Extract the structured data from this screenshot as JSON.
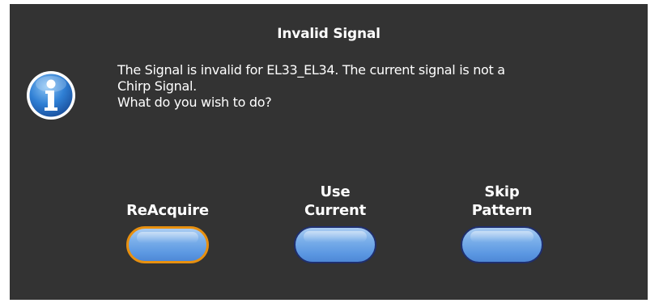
{
  "dialog": {
    "title": "Invalid Signal",
    "icon": "info-icon",
    "message": {
      "line1": "The Signal is invalid for EL33_EL34. The current signal is not a",
      "line2": "Chirp Signal.",
      "line3": "What do you wish to do?"
    }
  },
  "buttons": {
    "reacquire": {
      "label": "ReAcquire"
    },
    "use_current": {
      "line1": "Use",
      "line2": "Current"
    },
    "skip_pattern": {
      "line1": "Skip",
      "line2": "Pattern"
    }
  },
  "colors": {
    "background": "#333333",
    "button_fill": "#5c98e2",
    "button_border": "#1f2f6e",
    "focus_border": "#e8900f"
  }
}
